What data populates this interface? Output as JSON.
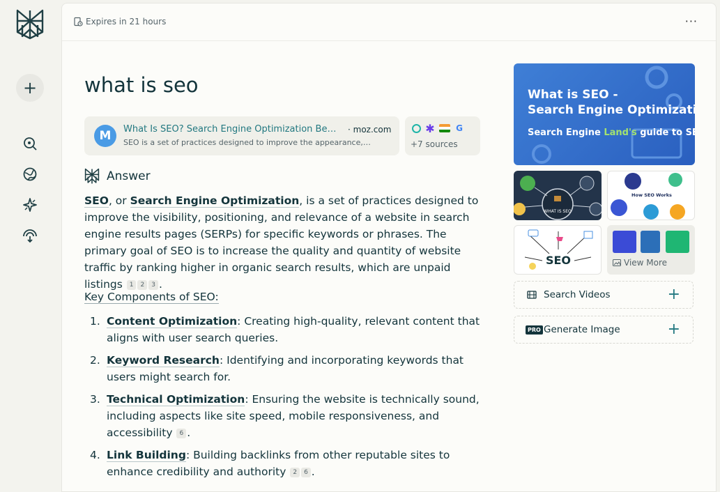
{
  "sidebar": {
    "new_label": "+"
  },
  "header": {
    "expires": "Expires in 21 hours",
    "more": "···"
  },
  "query": "what is seo",
  "source_card": {
    "logo_letter": "M",
    "title": "What Is SEO? Search Engine Optimization Be…",
    "domain": "· moz.com",
    "snippet": "SEO is a set of practices designed to improve the appearance,…"
  },
  "sources_more": {
    "label": "+7 sources"
  },
  "answer": {
    "heading": "Answer",
    "intro_term1": "SEO",
    "intro_mid1": ", or ",
    "intro_term2": "Search Engine Optimization",
    "intro_rest": ", is a set of practices designed to improve the visibility, positioning, and relevance of a website in search engine results pages (SERPs) for specific keywords or phrases. The primary goal of SEO is to increase the quality and quantity of website traffic by ranking higher in organic search results, which are unpaid listings",
    "intro_cites": [
      "1",
      "2",
      "3"
    ],
    "section_heading": "Key Components of SEO:",
    "items": [
      {
        "num": "1.",
        "term": "Content Optimization",
        "text": ": Creating high-quality, relevant content that aligns with user search queries.",
        "cites": []
      },
      {
        "num": "2.",
        "term": "Keyword Research",
        "text": ": Identifying and incorporating keywords that users might search for.",
        "cites": []
      },
      {
        "num": "3.",
        "term": "Technical Optimization",
        "text": ": Ensuring the website is technically sound, including aspects like site speed, mobile responsiveness, and accessibility",
        "cites": [
          "6"
        ]
      },
      {
        "num": "4.",
        "term": "Link Building",
        "text": ": Building backlinks from other reputable sites to enhance credibility and authority",
        "cites": [
          "2",
          "6"
        ]
      }
    ]
  },
  "media": {
    "hero_line1": "What is SEO -",
    "hero_line2": "Search Engine Optimization?",
    "hero_line3_a": "Search Engine ",
    "hero_line3_b": "Land's",
    "hero_line3_c": " guide to SEO",
    "thumb1_text": "WHAT IS SEO",
    "thumb2_text": "How SEO Works",
    "thumb3_text": "SEO",
    "view_more": "View More"
  },
  "actions": {
    "search_videos": "Search Videos",
    "generate_image": "Generate Image",
    "pro_badge": "PRO",
    "plus": "+"
  },
  "colors": {
    "accent": "#227880",
    "text": "#13343b",
    "background": "#f3f3ee",
    "panel": "#fcfcf9"
  }
}
